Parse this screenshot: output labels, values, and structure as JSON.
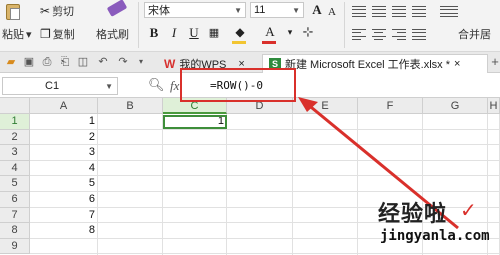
{
  "ribbon": {
    "paste_label": "粘贴",
    "paste_dropdown": "▾",
    "cut_label": "剪切",
    "copy_label": "复制",
    "format_painter_label": "格式刷",
    "font_name": "宋体",
    "font_size": "11",
    "grow_font": "A",
    "shrink_font": "A",
    "bold": "B",
    "italic": "I",
    "underline": "U",
    "merge_label": "合并居",
    "font_color": "#d9302b",
    "fill_color": "#f2c531"
  },
  "tabs": {
    "wps_tab_label": "我的WPS",
    "wps_close": "×",
    "doc_tab_label": "新建 Microsoft Excel 工作表.xlsx *",
    "doc_close": "×",
    "add_tab": "+"
  },
  "formula_bar": {
    "name_box": "C1",
    "fx": "fx",
    "formula": "=ROW()-0"
  },
  "sheet": {
    "columns": [
      "A",
      "B",
      "C",
      "D",
      "E",
      "F",
      "G",
      "H"
    ],
    "rows": [
      "1",
      "2",
      "3",
      "4",
      "5",
      "6",
      "7",
      "8",
      "9"
    ],
    "column_a_values": [
      "1",
      "2",
      "3",
      "4",
      "5",
      "6",
      "7",
      "8",
      ""
    ],
    "c1_value": "1",
    "selected_column": "C",
    "selected_row": "1",
    "selection_color": "#3e8e3a"
  },
  "annotation_color": "#d9302b",
  "watermark": {
    "title": "经验啦",
    "check": "✓",
    "domain": "jingyanla.com"
  }
}
